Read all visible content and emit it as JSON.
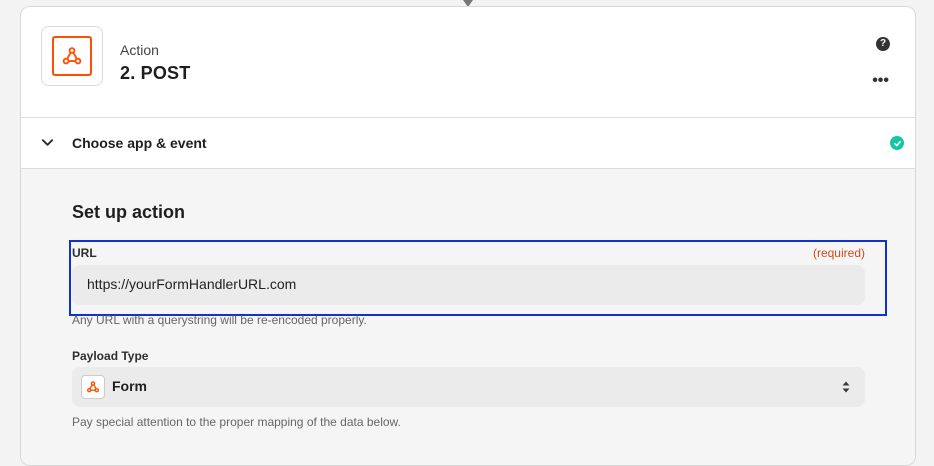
{
  "colors": {
    "brand": "#ff4f00",
    "success": "#13c7a5",
    "highlight": "#1033c9",
    "required": "#d14a1f"
  },
  "step": {
    "type_label": "Action",
    "title": "2. POST",
    "app_icon": "webhook-icon",
    "help_icon": "help-icon",
    "more_icon": "more-options-icon"
  },
  "section": {
    "label": "Choose app & event",
    "status_icon": "check-circle-icon",
    "toggle_icon": "chevron-down-icon"
  },
  "setup": {
    "title": "Set up action",
    "url_field": {
      "label": "URL",
      "required_text": "(required)",
      "value": "https://yourFormHandlerURL.com",
      "helper": "Any URL with a querystring will be re-encoded properly."
    },
    "payload_field": {
      "label": "Payload Type",
      "value": "Form",
      "icon": "webhook-icon",
      "helper": "Pay special attention to the proper mapping of the data below."
    }
  }
}
